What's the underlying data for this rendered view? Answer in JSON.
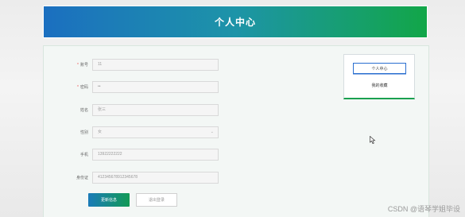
{
  "header": {
    "title": "个人中心"
  },
  "form": {
    "fields": [
      {
        "label": "账号",
        "required": true,
        "value": "11",
        "type": "text"
      },
      {
        "label": "密码",
        "required": true,
        "value": "••",
        "type": "password"
      },
      {
        "label": "姓名",
        "required": false,
        "value": "张三",
        "type": "text"
      },
      {
        "label": "性别",
        "required": false,
        "value": "女",
        "type": "select"
      },
      {
        "label": "手机",
        "required": false,
        "value": "13922222222",
        "type": "text"
      },
      {
        "label": "身份证",
        "required": false,
        "value": "412345678912345678",
        "type": "text"
      }
    ],
    "update_label": "更新信息",
    "logout_label": "退出登录"
  },
  "side_menu": {
    "items": [
      {
        "label": "个人中心",
        "active": true
      },
      {
        "label": "我的收藏",
        "active": false
      }
    ]
  },
  "watermark": "CSDN @语琴学姐毕设",
  "colors": {
    "header_start": "#1b6fc0",
    "header_end": "#12a648",
    "accent": "#1aa04f"
  },
  "icons": {
    "cursor": "mouse-pointer-icon",
    "select": "chevron-down-icon"
  }
}
